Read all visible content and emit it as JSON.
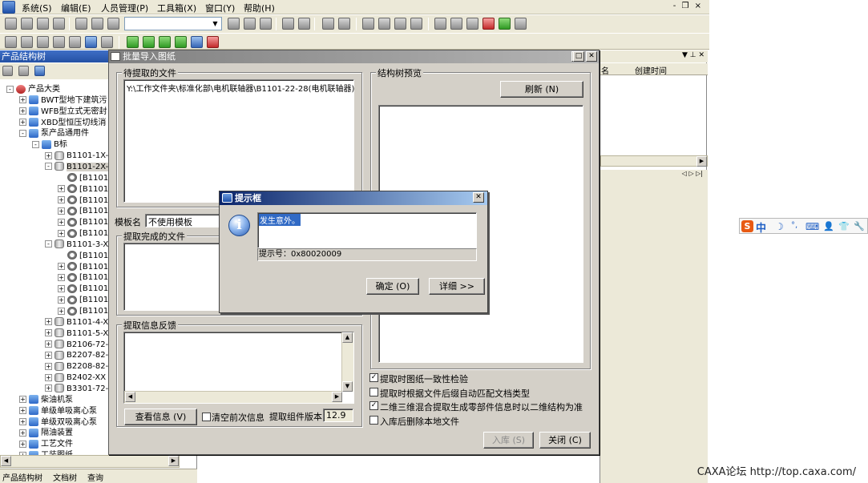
{
  "menubar": {
    "items": [
      "系统(S)",
      "编辑(E)",
      "人员管理(P)",
      "工具箱(X)",
      "窗口(Y)",
      "帮助(H)"
    ],
    "window_controls": "- ❐ ×"
  },
  "left_panel": {
    "title": "产品结构树",
    "tree": [
      {
        "label": "产品大类",
        "level": 0,
        "expander": "-",
        "icon": "red"
      },
      {
        "label": "BWT型地下建筑污",
        "level": 1,
        "expander": "+",
        "icon": "prod"
      },
      {
        "label": "WFB型立式无密封",
        "level": 1,
        "expander": "+",
        "icon": "prod"
      },
      {
        "label": "XBD型恒压切线消",
        "level": 1,
        "expander": "+",
        "icon": "prod"
      },
      {
        "label": "泵产品通用件",
        "level": 1,
        "expander": "-",
        "icon": "prod"
      },
      {
        "label": "B标",
        "level": 2,
        "expander": "-",
        "icon": "prod"
      },
      {
        "label": "B1101-1X-",
        "level": 3,
        "expander": "+",
        "icon": "db"
      },
      {
        "label": "B1101-2X-",
        "level": 3,
        "expander": "-",
        "icon": "db"
      },
      {
        "label": "[B1101",
        "level": 4,
        "expander": "",
        "icon": "gear"
      },
      {
        "label": "[B1101",
        "level": 4,
        "expander": "+",
        "icon": "gear"
      },
      {
        "label": "[B1101",
        "level": 4,
        "expander": "+",
        "icon": "gear"
      },
      {
        "label": "[B1101",
        "level": 4,
        "expander": "+",
        "icon": "gear"
      },
      {
        "label": "[B1101",
        "level": 4,
        "expander": "+",
        "icon": "gear"
      },
      {
        "label": "[B1101",
        "level": 4,
        "expander": "+",
        "icon": "gear"
      },
      {
        "label": "B1101-3-X",
        "level": 3,
        "expander": "-",
        "icon": "db"
      },
      {
        "label": "[B1101",
        "level": 4,
        "expander": "",
        "icon": "gear"
      },
      {
        "label": "[B1101",
        "level": 4,
        "expander": "+",
        "icon": "gear"
      },
      {
        "label": "[B1101",
        "level": 4,
        "expander": "+",
        "icon": "gear"
      },
      {
        "label": "[B1101",
        "level": 4,
        "expander": "+",
        "icon": "gear"
      },
      {
        "label": "[B1101",
        "level": 4,
        "expander": "+",
        "icon": "gear"
      },
      {
        "label": "[B1101",
        "level": 4,
        "expander": "+",
        "icon": "gear"
      },
      {
        "label": "B1101-4-X",
        "level": 3,
        "expander": "+",
        "icon": "db"
      },
      {
        "label": "B1101-5-X",
        "level": 3,
        "expander": "+",
        "icon": "db"
      },
      {
        "label": "B2106-72-",
        "level": 3,
        "expander": "+",
        "icon": "db"
      },
      {
        "label": "B2207-82-",
        "level": 3,
        "expander": "+",
        "icon": "db"
      },
      {
        "label": "B2208-82-",
        "level": 3,
        "expander": "+",
        "icon": "db"
      },
      {
        "label": "B2402-XX",
        "level": 3,
        "expander": "+",
        "icon": "db"
      },
      {
        "label": "B3301-72-",
        "level": 3,
        "expander": "+",
        "icon": "db"
      },
      {
        "label": "柴油机泵",
        "level": 1,
        "expander": "+",
        "icon": "prod"
      },
      {
        "label": "单级单吸离心泵",
        "level": 1,
        "expander": "+",
        "icon": "prod"
      },
      {
        "label": "单级双吸离心泵",
        "level": 1,
        "expander": "+",
        "icon": "prod"
      },
      {
        "label": "隔油装置",
        "level": 1,
        "expander": "+",
        "icon": "prod"
      },
      {
        "label": "工艺文件",
        "level": 1,
        "expander": "+",
        "icon": "prod"
      },
      {
        "label": "工装图纸",
        "level": 1,
        "expander": "+",
        "icon": "prod"
      }
    ],
    "tabs": [
      "产品结构树",
      "文档树",
      "查询"
    ]
  },
  "right_panel": {
    "columns": [
      "名",
      "创建时间"
    ]
  },
  "import_dialog": {
    "title": "批量导入图纸",
    "pending_group": "待提取的文件",
    "pending_files": [
      "Y:\\工作文件夹\\标准化部\\电机联轴器\\B1101-22-28(电机联轴器)"
    ],
    "template_label": "模板名",
    "template_value": "不使用模板",
    "done_group": "提取完成的文件",
    "feedback_group": "提取信息反馈",
    "view_info_button": "查看信息 (V)",
    "clear_prev_label": "清空前次信息",
    "clear_prev_checked": false,
    "component_version_label": "提取组件版本",
    "component_version_value": "12.9",
    "preview_group": "结构树预览",
    "refresh_button": "刷新 (N)",
    "options": [
      {
        "label": "提取时图纸一致性检验",
        "checked": true
      },
      {
        "label": "提取时根据文件后缀自动匹配文档类型",
        "checked": false
      },
      {
        "label": "二维三维混合提取生成零部件信息时以二维结构为准",
        "checked": true
      },
      {
        "label": "入库后删除本地文件",
        "checked": false
      }
    ],
    "store_button": "入库 (S)",
    "close_button": "关闭 (C)"
  },
  "alert_dialog": {
    "title": "提示框",
    "message": "发生意外。",
    "code_text": "提示号：0x80020009",
    "ok_button": "确定 (O)",
    "details_button": "详细 >>"
  },
  "ime_bar": {
    "logo": "S",
    "mode": "中",
    "icons": [
      "☽",
      "°,",
      "⌨",
      "👤",
      "👕",
      "🔧"
    ]
  },
  "watermark": "CAXA论坛 http://top.caxa.com/"
}
